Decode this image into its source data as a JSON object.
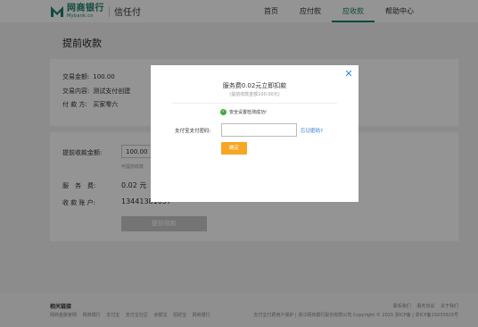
{
  "header": {
    "logo_cn": "网商银行",
    "logo_en": "Mybank.cn",
    "product": "信任付",
    "nav": [
      {
        "label": "首页"
      },
      {
        "label": "应付款"
      },
      {
        "label": "应收款",
        "active": true
      },
      {
        "label": "帮助中心"
      }
    ]
  },
  "page": {
    "title": "提前收款"
  },
  "order": {
    "amount_label": "交易金额:",
    "amount_value": "100.00",
    "content_label": "交易内容:",
    "content_value": "测试支付创建",
    "payer_label": "付 款 方:",
    "payer_value": "买家零六"
  },
  "form": {
    "advance_label": "提前收款金额:",
    "advance_value": "100.00",
    "advance_hint": "可提前收款",
    "fee_label": "服　务　费:",
    "fee_value": "0.02 元",
    "account_label": "收 款 账 户:",
    "account_value": "13441381037",
    "submit_label": "提前收款"
  },
  "footer": {
    "title": "相关链接",
    "links": [
      "网商金融官网",
      "网商银行",
      "支付宝",
      "支付宝社区",
      "余额宝",
      "招财宝",
      "网商银行"
    ],
    "right_links": [
      "联系我们",
      "服务协议",
      "关于我们"
    ],
    "copyright": "支付宝付费用户保护 | 浙江网商银行股份有限公司 Copyright © 2015 浙ICP备 | 浙ICP备15033925号"
  },
  "modal": {
    "close_icon": "close-icon",
    "title": "服务费0.02元立即扣款",
    "subtitle": "(提前收款金额100.00元)",
    "status_text": "安全设置检测成功!",
    "password_label": "支付宝支付密码:",
    "password_value": "",
    "forgot_link": "忘记密码?",
    "confirm_label": "确定"
  },
  "colors": {
    "brand": "#1a7f6b",
    "confirm": "#f5a623",
    "close": "#2a8ae8",
    "success": "#3aae3a"
  }
}
